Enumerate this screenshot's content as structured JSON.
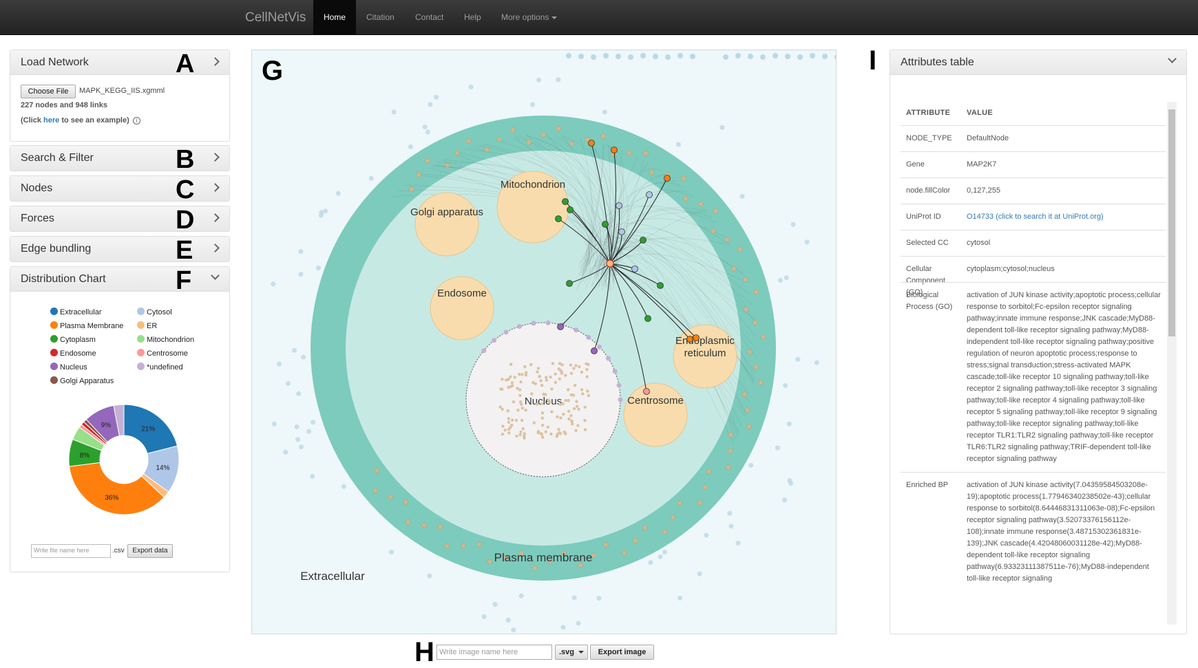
{
  "nav": {
    "brand": "CellNetVis",
    "items": [
      "Home",
      "Citation",
      "Contact",
      "Help",
      "More options"
    ]
  },
  "left": {
    "load_network": {
      "title": "Load Network",
      "letter": "A",
      "choose_file": "Choose File",
      "file_name": "MAPK_KEGG_IIS.xgmml",
      "stats": "227 nodes and 948 links",
      "example_prefix": "(Click ",
      "example_link": "here",
      "example_suffix": " to see an example)"
    },
    "search_filter": {
      "title": "Search & Filter",
      "letter": "B"
    },
    "nodes": {
      "title": "Nodes",
      "letter": "C"
    },
    "forces": {
      "title": "Forces",
      "letter": "D"
    },
    "edge_bundling": {
      "title": "Edge bundling",
      "letter": "E"
    },
    "distribution": {
      "title": "Distribution Chart",
      "letter": "F",
      "filename_placeholder": "Write file name here",
      "ext": ".csv",
      "export": "Export data"
    }
  },
  "legend": [
    {
      "label": "Extracellular",
      "color": "#1f77b4"
    },
    {
      "label": "Cytosol",
      "color": "#aec7e8"
    },
    {
      "label": "Plasma Membrane",
      "color": "#ff7f0e"
    },
    {
      "label": "ER",
      "color": "#ffbb78"
    },
    {
      "label": "Cytoplasm",
      "color": "#2ca02c"
    },
    {
      "label": "Mitochondrion",
      "color": "#98df8a"
    },
    {
      "label": "Endosome",
      "color": "#d62728"
    },
    {
      "label": "Centrosome",
      "color": "#ff9896"
    },
    {
      "label": "Nucleus",
      "color": "#9467bd"
    },
    {
      "label": "*undefined",
      "color": "#c5b0d5"
    },
    {
      "label": "Golgi Apparatus",
      "color": "#8c564b"
    }
  ],
  "chart_data": {
    "type": "pie",
    "categories": [
      "Extracellular",
      "Cytosol",
      "ER",
      "Plasma Membrane",
      "Cytoplasm",
      "Mitochondrion",
      "Centrosome",
      "Endosome",
      "Golgi Apparatus",
      "Nucleus",
      "*undefined"
    ],
    "values": [
      21,
      14,
      2,
      36,
      8,
      4,
      1,
      1,
      1,
      9,
      3
    ],
    "labels": [
      "21%",
      "14%",
      "",
      "36%",
      "8%",
      "",
      "",
      "",
      "",
      "9%",
      ""
    ],
    "colors": [
      "#1f77b4",
      "#aec7e8",
      "#ffbb78",
      "#ff7f0e",
      "#2ca02c",
      "#98df8a",
      "#ff9896",
      "#d62728",
      "#8c564b",
      "#9467bd",
      "#c5b0d5"
    ]
  },
  "graph": {
    "letter": "G",
    "labels": {
      "golgi": "Golgi apparatus",
      "mito": "Mitochondrion",
      "endosome": "Endosome",
      "er1": "Endoplasmic",
      "er2": "reticulum",
      "nucleus": "Nucleus",
      "centrosome": "Centrosome",
      "plasma": "Plasma membrane",
      "extracellular": "Extracellular"
    }
  },
  "export_bar": {
    "letter": "H",
    "placeholder": "Write image name here",
    "format": ".svg",
    "export": "Export image"
  },
  "attributes": {
    "letter": "I",
    "title": "Attributes table",
    "col_attr": "ATTRIBUTE",
    "col_val": "VALUE",
    "rows": [
      {
        "key": "NODE_TYPE",
        "value": "DefaultNode"
      },
      {
        "key": "Gene",
        "value": "MAP2K7"
      },
      {
        "key": "node.fillColor",
        "value": "0,127,255"
      },
      {
        "key": "UniProt ID",
        "value": "O14733 (click to search it at UniProt.org)",
        "link": true
      },
      {
        "key": "Selected CC",
        "value": "cytosol"
      },
      {
        "key": "Cellular Component (GO)",
        "value": "cytoplasm;cytosol;nucleus"
      },
      {
        "key": "Biological Process (GO)",
        "value": "activation of JUN kinase activity;apoptotic process;cellular response to sorbitol;Fc-epsilon receptor signaling pathway;innate immune response;JNK cascade;MyD88-dependent toll-like receptor signaling pathway;MyD88-independent toll-like receptor signaling pathway;positive regulation of neuron apoptotic process;response to stress;signal transduction;stress-activated MAPK cascade;toll-like receptor 10 signaling pathway;toll-like receptor 2 signaling pathway;toll-like receptor 3 signaling pathway;toll-like receptor 4 signaling pathway;toll-like receptor 5 signaling pathway;toll-like receptor 9 signaling pathway;toll-like receptor signaling pathway;toll-like receptor TLR1:TLR2 signaling pathway;toll-like receptor TLR6:TLR2 signaling pathway;TRIF-dependent toll-like receptor signaling pathway"
      },
      {
        "key": "Enriched BP",
        "value": "activation of JUN kinase activity(7.04359584503208e-19);apoptotic process(1.77946340238502e-43);cellular response to sorbitol(8.64446831311063e-08);Fc-epsilon receptor signaling pathway(3.52073376156112e-108);innate immune response(3.48715302361831e-139);JNK cascade(4.42048060031128e-42);MyD88-dependent toll-like receptor signaling pathway(6.93323111387511e-76);MyD88-independent toll-like receptor signaling"
      }
    ]
  }
}
